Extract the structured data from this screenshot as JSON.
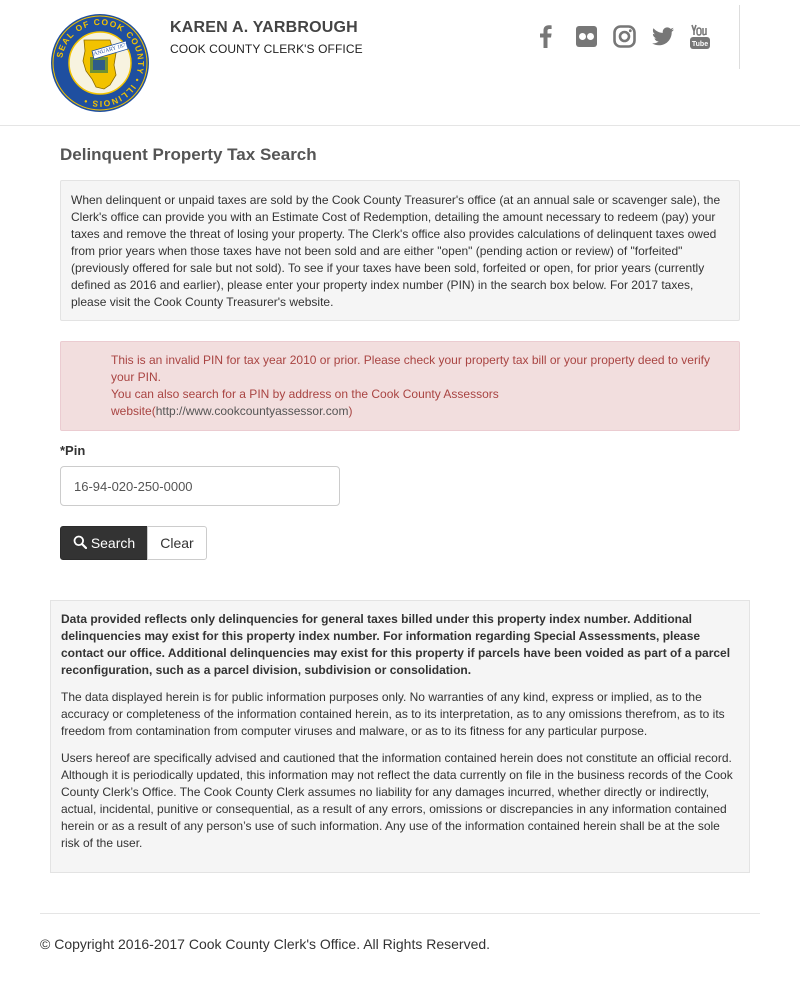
{
  "header": {
    "official_name": "KAREN A. YARBROUGH",
    "office_name": "COOK COUNTY CLERK'S OFFICE",
    "seal": {
      "ring_text": "SEAL OF COOK COUNTY • ILLINOIS •",
      "banner_text": "JANUARY 1871",
      "colors": {
        "ring": "#1f4fa0",
        "gold": "#f2c200",
        "green": "#5a8a3a"
      }
    },
    "social_icons": [
      {
        "name": "facebook-icon"
      },
      {
        "name": "flickr-icon"
      },
      {
        "name": "instagram-icon"
      },
      {
        "name": "twitter-icon"
      },
      {
        "name": "youtube-icon"
      }
    ],
    "icon_color": "#777777"
  },
  "main": {
    "title": "Delinquent Property Tax Search",
    "intro": "When delinquent or unpaid taxes are sold by the Cook County Treasurer's office (at an annual sale or scavenger sale), the Clerk's office can provide you with an Estimate Cost of Redemption, detailing the amount necessary to redeem (pay) your taxes and remove the threat of losing your property. The Clerk's office also provides calculations of delinquent taxes owed from prior years when those taxes have not been sold and are either \"open\" (pending action or review) of \"forfeited\" (previously offered for sale but not sold). To see if your taxes have been sold, forfeited or open, for prior years (currently defined as 2016 and earlier), please enter your property index number (PIN) in the search box below. For 2017 taxes, please visit the Cook County Treasurer's website.",
    "alert": {
      "line1": "This is an invalid PIN for tax year 2010 or prior. Please check your property tax bill or your property deed to verify your PIN.",
      "line2_prefix": "You can also search for a PIN by address on the Cook County Assessors website(",
      "line2_url": "http://www.cookcountyassessor.com",
      "line2_suffix": ")",
      "color": "#a94442"
    },
    "pin_label": "*Pin",
    "pin_value": "16-94-020-250-0000",
    "search_button": "Search",
    "clear_button": "Clear"
  },
  "disclaimer": {
    "bold_paragraph": "Data provided reflects only delinquencies for general taxes billed under this property index number. Additional delinquencies may exist for this property index number. For information regarding Special Assessments, please contact our office. Additional delinquencies may exist for this property if parcels have been voided as part of a parcel reconfiguration, such as a parcel division, subdivision or consolidation.",
    "paragraph2": "The data displayed herein is for public information purposes only. No warranties of any kind, express or implied, as to the accuracy or completeness of the information contained herein, as to its interpretation, as to any omissions therefrom, as to its freedom from contamination from computer viruses and malware, or as to its fitness for any particular purpose.",
    "paragraph3": "Users hereof are specifically advised and cautioned that the information contained herein does not constitute an official record. Although it is periodically updated, this information may not reflect the data currently on file in the business records of the Cook County Clerk’s Office. The Cook County Clerk assumes no liability for any damages incurred, whether directly or indirectly, actual, incidental, punitive or consequential, as a result of any errors, omissions or discrepancies in any information contained herein or as a result of any person’s use of such information. Any use of the information contained herein shall be at the sole risk of the user."
  },
  "footer": {
    "copyright": "© Copyright 2016-2017 Cook County Clerk's Office. All Rights Reserved."
  }
}
